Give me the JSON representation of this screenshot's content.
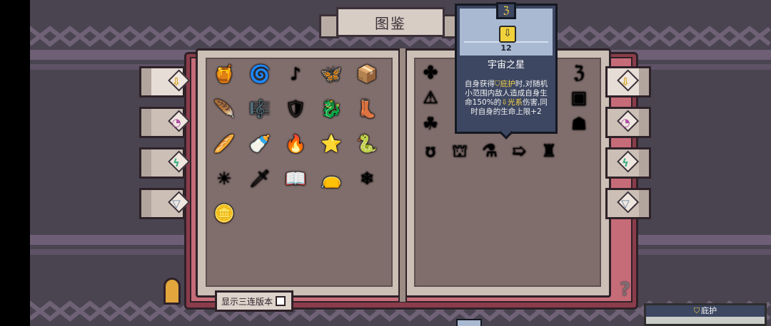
{
  "title": "图鉴",
  "colors": {
    "zigzag": "#8e7b95",
    "gold": "#f2d23a",
    "tooltip_bg": "#3d4762"
  },
  "left_tabs": [
    {
      "icon": "light-element-icon",
      "glyph": "⇩",
      "color": "#d7a21f",
      "active": true
    },
    {
      "icon": "swirl-element-icon",
      "glyph": "◔",
      "color": "#b04fa6",
      "active": false
    },
    {
      "icon": "lightning-element-icon",
      "glyph": "ϟ",
      "color": "#3fae84",
      "active": false
    },
    {
      "icon": "wind-element-icon",
      "glyph": "▽",
      "color": "#5f7e9e",
      "active": false
    }
  ],
  "right_tabs": [
    {
      "icon": "light-element-icon",
      "glyph": "⇩",
      "color": "#d7a21f",
      "active": true
    },
    {
      "icon": "swirl-element-icon",
      "glyph": "◔",
      "color": "#b04fa6",
      "active": false
    },
    {
      "icon": "lightning-element-icon",
      "glyph": "ϟ",
      "color": "#3fae84",
      "active": false
    },
    {
      "icon": "wind-element-icon",
      "glyph": "▽",
      "color": "#5f7e9e",
      "active": false
    }
  ],
  "left_items": [
    {
      "icon": "pot-icon",
      "glyph": "🍯"
    },
    {
      "icon": "orb-swirl-icon",
      "glyph": "🌀"
    },
    {
      "icon": "music-note-icon",
      "glyph": "♪"
    },
    {
      "icon": "butterfly-wings-icon",
      "glyph": "🦋"
    },
    {
      "icon": "wooden-box-icon",
      "glyph": "📦"
    },
    {
      "icon": "feather-icon",
      "glyph": "🪶"
    },
    {
      "icon": "lyre-icon",
      "glyph": "🎼"
    },
    {
      "icon": "winged-shield-icon",
      "glyph": "🛡"
    },
    {
      "icon": "green-dragon-icon",
      "glyph": "🐉"
    },
    {
      "icon": "boot-icon",
      "glyph": "👢"
    },
    {
      "icon": "bread-icon",
      "glyph": "🥖"
    },
    {
      "icon": "bottle-icon",
      "glyph": "🍼"
    },
    {
      "icon": "torch-icon",
      "glyph": "🔥"
    },
    {
      "icon": "star-icon",
      "glyph": "⭐"
    },
    {
      "icon": "serpent-ring-icon",
      "glyph": "🐍"
    },
    {
      "icon": "sun-emblem-icon",
      "glyph": "☀"
    },
    {
      "icon": "sword-icon",
      "glyph": "🗡"
    },
    {
      "icon": "spellbook-icon",
      "glyph": "📖"
    },
    {
      "icon": "pouch-icon",
      "glyph": "👝"
    },
    {
      "icon": "ice-shard-icon",
      "glyph": "❄"
    },
    {
      "icon": "gold-nugget-icon",
      "glyph": "🪙"
    }
  ],
  "right_items": [
    {
      "icon": "sparkle-icon",
      "glyph": "✤"
    },
    {
      "icon": "triangle-rune-icon",
      "glyph": "⚠"
    },
    {
      "icon": "triple-orb-icon",
      "glyph": "☘"
    },
    {
      "icon": "glyph-mark-icon",
      "glyph": "ℨ"
    },
    {
      "icon": "frame-icon",
      "glyph": "▣"
    },
    {
      "icon": "fence-icon",
      "glyph": "☗"
    },
    {
      "icon": "green-mark-icon",
      "glyph": "ʊ"
    },
    {
      "icon": "crown-box-icon",
      "glyph": "⛫"
    },
    {
      "icon": "flask-icon",
      "glyph": "⚗"
    },
    {
      "icon": "arrow-block-icon",
      "glyph": "➯"
    },
    {
      "icon": "crystal-cluster-icon",
      "glyph": "♜"
    }
  ],
  "tooltip": {
    "top_icon": "glyph-mark-icon",
    "top_glyph": "ℨ",
    "item_icon": "light-element-icon",
    "item_glyph": "⇩",
    "level": "12",
    "name": "宇宙之星",
    "desc_1": "自身获得",
    "desc_shield_icon": "shield-icon",
    "desc_shield_glyph": "⛉",
    "desc_keyword_1": "庇护",
    "desc_2": "时,对随机小范围内敌人造成自身生命150%的",
    "desc_light_icon": "light-element-icon",
    "desc_light_glyph": "⇩",
    "desc_keyword_2": "光系",
    "desc_3": "伤害,同时自身的生命上限+2"
  },
  "toggle_label": "显示三连版本",
  "bottom_panel_icon": "shield-icon",
  "bottom_panel_glyph": "⛉",
  "bottom_panel_title": "庇护"
}
